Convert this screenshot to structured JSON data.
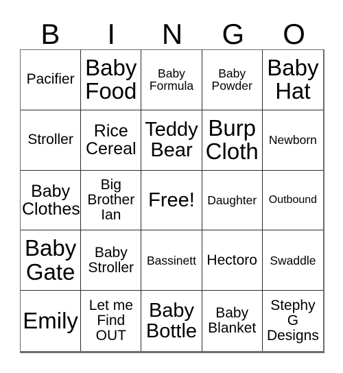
{
  "card": {
    "title_letters": [
      "B",
      "I",
      "N",
      "G",
      "O"
    ],
    "colors": {
      "background": "#ffffff",
      "text": "#000000",
      "grid_line": "#2a2a2a",
      "outer_border": "#6b6b6b"
    },
    "grid": {
      "columns": 5,
      "rows": 5,
      "cells": [
        {
          "text": "Pacifier",
          "size": "m"
        },
        {
          "text": "Baby\nFood",
          "size": "xxl"
        },
        {
          "text": "Baby\nFormula",
          "size": "s"
        },
        {
          "text": "Baby\nPowder",
          "size": "s"
        },
        {
          "text": "Baby\nHat",
          "size": "xxl"
        },
        {
          "text": "Stroller",
          "size": "m"
        },
        {
          "text": "Rice\nCereal",
          "size": "l"
        },
        {
          "text": "Teddy\nBear",
          "size": "xl"
        },
        {
          "text": "Burp\nCloth",
          "size": "xxl"
        },
        {
          "text": "Newborn",
          "size": "s"
        },
        {
          "text": "Baby\nClothes",
          "size": "l"
        },
        {
          "text": "Big\nBrother\nIan",
          "size": "m"
        },
        {
          "text": "Free!",
          "size": "xl"
        },
        {
          "text": "Daughter",
          "size": "s"
        },
        {
          "text": "Outbound",
          "size": "xs"
        },
        {
          "text": "Baby\nGate",
          "size": "xxl"
        },
        {
          "text": "Baby\nStroller",
          "size": "m"
        },
        {
          "text": "Bassinett",
          "size": "s"
        },
        {
          "text": "Hectoro",
          "size": "m"
        },
        {
          "text": "Swaddle",
          "size": "s"
        },
        {
          "text": "Emily",
          "size": "xxl"
        },
        {
          "text": "Let me\nFind\nOUT",
          "size": "m"
        },
        {
          "text": "Baby\nBottle",
          "size": "xl"
        },
        {
          "text": "Baby\nBlanket",
          "size": "m"
        },
        {
          "text": "Stephy\nG\nDesigns",
          "size": "m"
        }
      ]
    }
  }
}
